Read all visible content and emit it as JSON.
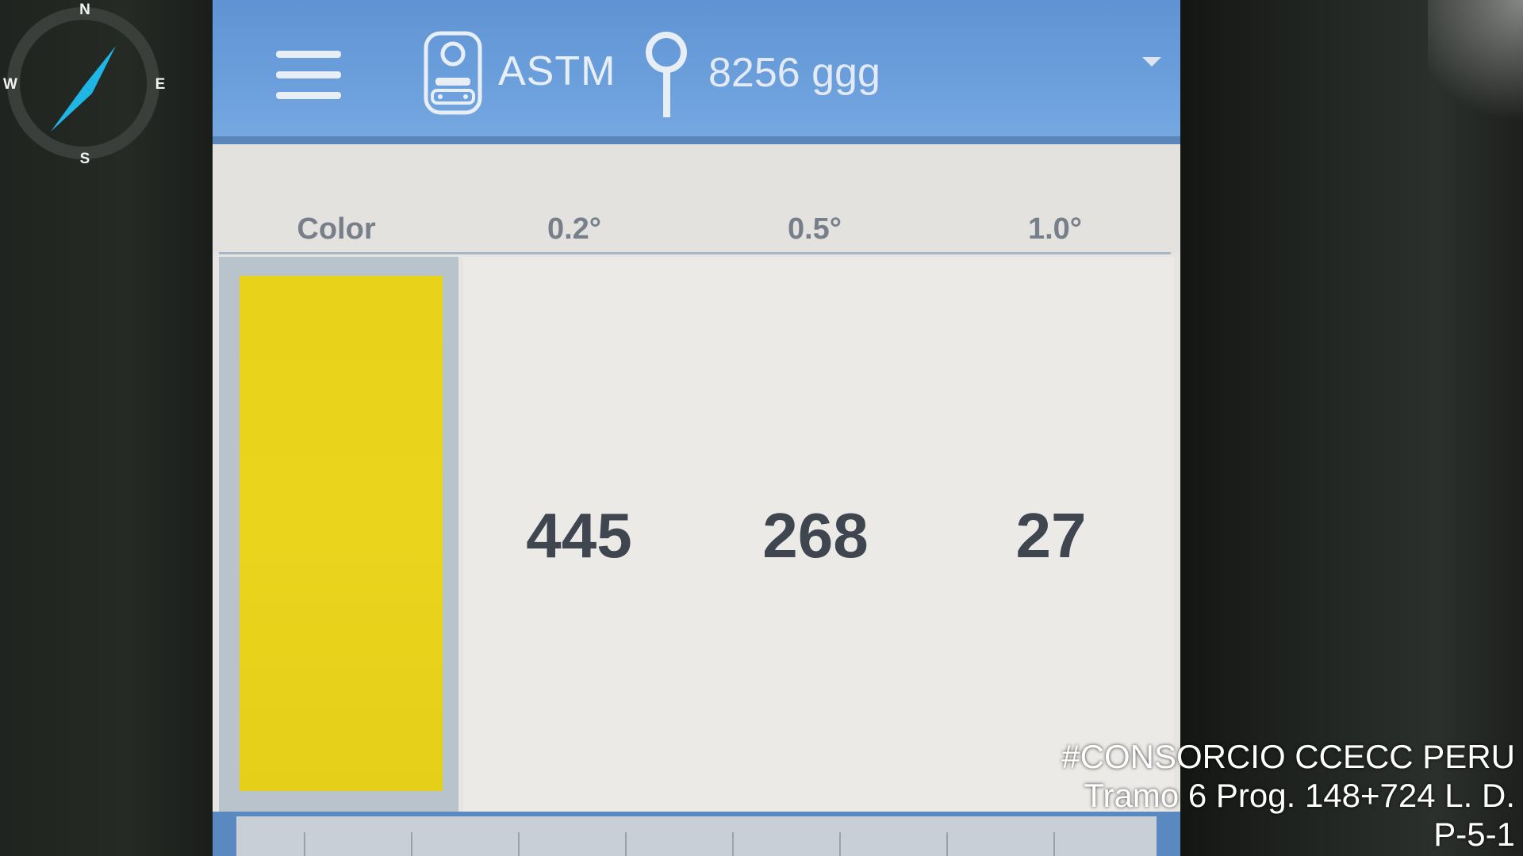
{
  "compass": {
    "north": "N",
    "south": "S",
    "east": "E",
    "west": "W",
    "needle_color": "#1fb6e6"
  },
  "header": {
    "menu_icon": "hamburger-menu-icon",
    "device_icon": "retroreflectometer-device-icon",
    "standard": "ASTM",
    "pin_icon": "location-pin-icon",
    "geometry": "8256 ggg",
    "dropdown_icon": "chevron-down-icon",
    "color": "#6b9fdc"
  },
  "table": {
    "columns": [
      "Color",
      "0.2°",
      "0.5°",
      "1.0°"
    ],
    "row": {
      "color_swatch": "#e8d21a",
      "values": [
        "445",
        "268",
        "27"
      ]
    }
  },
  "watermark": {
    "line1": "#CONSORCIO CCECC PERU",
    "line2": "Tramo 6 Prog. 148+724 L. D.",
    "line3": "P-5-1"
  }
}
